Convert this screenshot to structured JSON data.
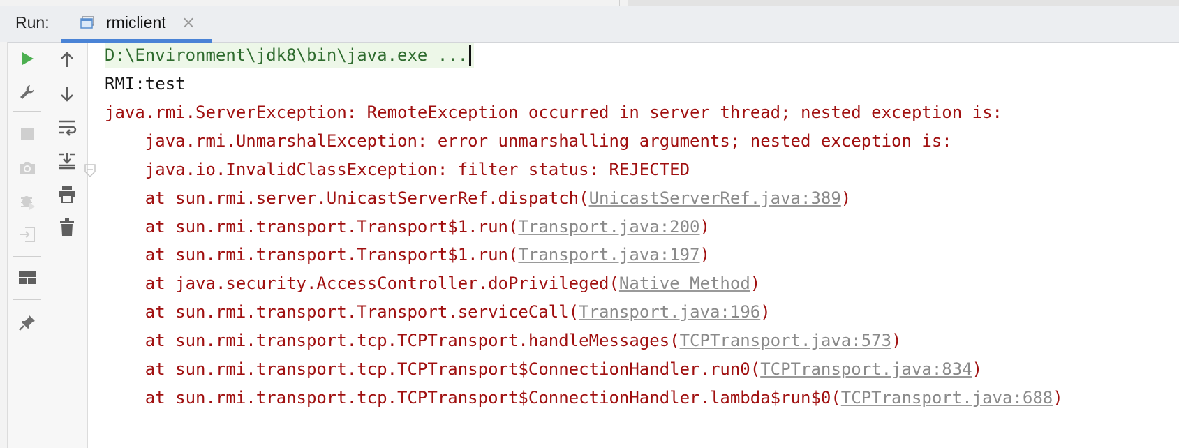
{
  "panel": {
    "run_label": "Run:"
  },
  "tab": {
    "label": "rmiclient",
    "close_glyph": "×",
    "icon": "console-window-icon"
  },
  "toolbar_left": [
    {
      "name": "rerun-icon",
      "color": "#4caf50"
    },
    {
      "name": "wrench-icon"
    },
    {
      "name": "stop-icon"
    },
    {
      "name": "camera-icon"
    },
    {
      "name": "bug-icon"
    },
    {
      "name": "login-icon"
    },
    {
      "name": "layout-icon"
    },
    {
      "name": "pin-icon"
    }
  ],
  "toolbar_right": [
    {
      "name": "arrow-up-icon"
    },
    {
      "name": "arrow-down-icon"
    },
    {
      "name": "soft-wrap-icon"
    },
    {
      "name": "scroll-to-end-icon"
    },
    {
      "name": "print-icon"
    },
    {
      "name": "trash-icon"
    }
  ],
  "console": {
    "command": "D:\\Environment\\jdk8\\bin\\java.exe ...",
    "lines": [
      {
        "text": "RMI:test"
      },
      {
        "text": "java.rmi.ServerException: RemoteException occurred in server thread; nested exception is:"
      },
      {
        "text": "    java.rmi.UnmarshalException: error unmarshalling arguments; nested exception is:"
      },
      {
        "text": "    java.io.InvalidClassException: filter status: REJECTED"
      },
      {
        "prefix": "    at sun.rmi.server.UnicastServerRef.dispatch(",
        "link": "UnicastServerRef.java:389",
        "suffix": ")"
      },
      {
        "prefix": "    at sun.rmi.transport.Transport$1.run(",
        "link": "Transport.java:200",
        "suffix": ")"
      },
      {
        "prefix": "    at sun.rmi.transport.Transport$1.run(",
        "link": "Transport.java:197",
        "suffix": ")"
      },
      {
        "prefix": "    at java.security.AccessController.doPrivileged(",
        "link": "Native Method",
        "suffix": ")"
      },
      {
        "prefix": "    at sun.rmi.transport.Transport.serviceCall(",
        "link": "Transport.java:196",
        "suffix": ")"
      },
      {
        "prefix": "    at sun.rmi.transport.tcp.TCPTransport.handleMessages(",
        "link": "TCPTransport.java:573",
        "suffix": ")"
      },
      {
        "prefix": "    at sun.rmi.transport.tcp.TCPTransport$ConnectionHandler.run0(",
        "link": "TCPTransport.java:834",
        "suffix": ")"
      },
      {
        "prefix": "    at sun.rmi.transport.tcp.TCPTransport$ConnectionHandler.lambda$run$0(",
        "link": "TCPTransport.java:688",
        "suffix": ")"
      }
    ]
  },
  "colors": {
    "command_bg": "#edf7e8",
    "command_text": "#2e6b2e",
    "error_text": "#a01010",
    "link_text": "#8a8a8a",
    "tab_underline": "#4a83d6"
  }
}
